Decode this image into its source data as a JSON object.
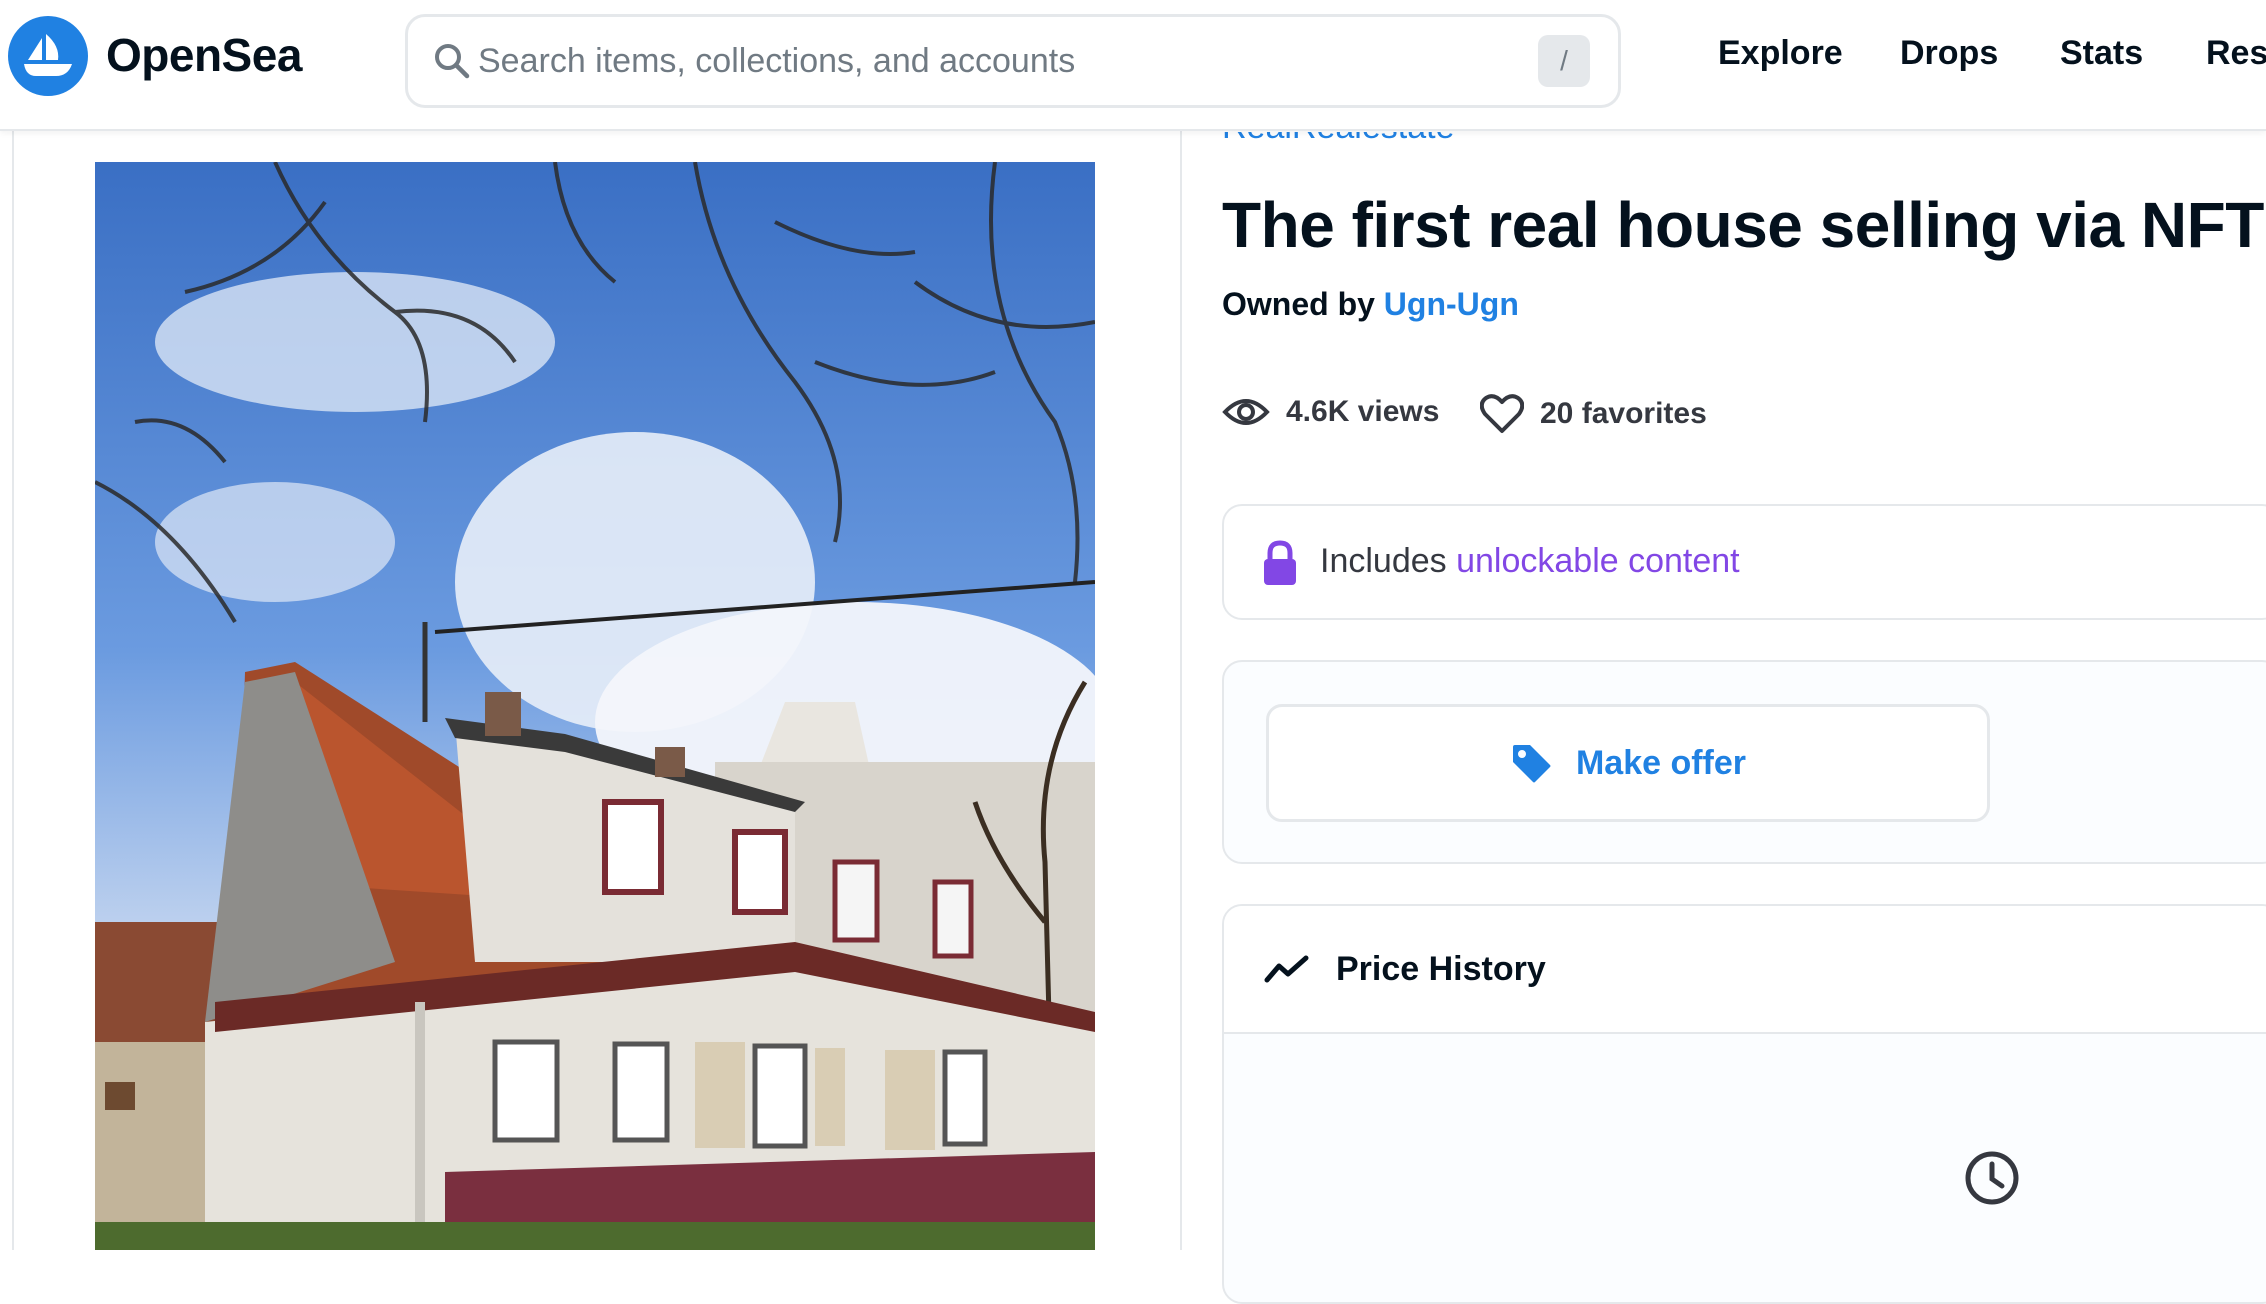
{
  "header": {
    "brand": "OpenSea",
    "search_placeholder": "Search items, collections, and accounts",
    "search_shortcut": "/",
    "nav": [
      "Explore",
      "Drops",
      "Stats",
      "Res"
    ]
  },
  "item": {
    "collection": "RealRealestate",
    "title": "The first real house selling via NFT",
    "owned_by_label": "Owned by",
    "owner": "Ugn-Ugn",
    "views": "4.6K views",
    "favorites": "20 favorites",
    "unlock_prefix": "Includes",
    "unlock_link": "unlockable content",
    "make_offer": "Make offer",
    "price_history": "Price History"
  },
  "colors": {
    "brand_blue": "#2081e2",
    "unlock_purple": "#8247e5",
    "text_dark": "#04111d",
    "border": "#e5e8eb"
  },
  "icons": [
    "opensea-logo-icon",
    "search-icon",
    "eye-icon",
    "heart-icon",
    "lock-icon",
    "tag-icon",
    "trend-line-icon",
    "clock-icon"
  ]
}
